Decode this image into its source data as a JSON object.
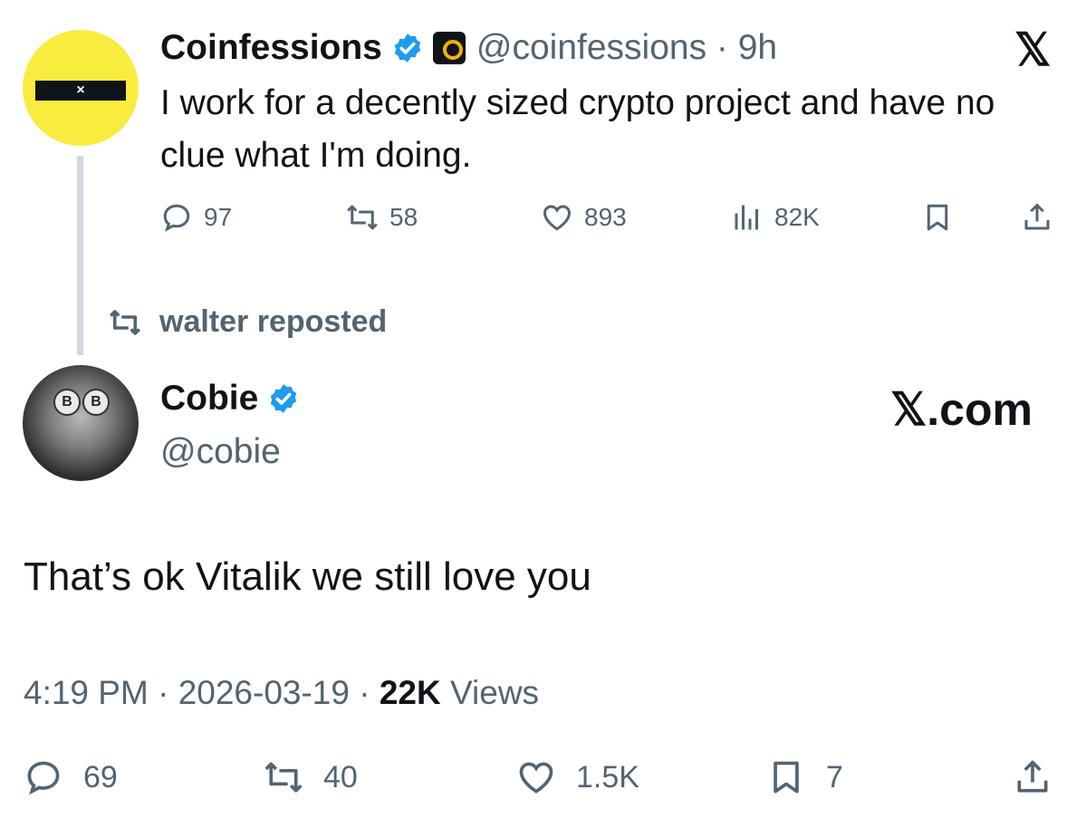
{
  "quoted_tweet": {
    "author_name": "Coinfessions",
    "handle_time": "@coinfessions · 9h",
    "avatar_text": "×",
    "text": "I work for a decently sized crypto project and have no clue what I'm doing.",
    "replies": "97",
    "reposts": "58",
    "likes": "893",
    "views": "82K"
  },
  "repost_banner": "walter reposted",
  "main_tweet": {
    "author_name": "Cobie",
    "handle": "@cobie",
    "text": "That’s ok Vitalik we still love you",
    "time": "4:19 PM",
    "date": "2026-03-19",
    "views_count": "22K",
    "views_label": "Views",
    "replies": "69",
    "reposts": "40",
    "likes": "1.5K",
    "bookmarks": "7",
    "avatar_glass_text": "B"
  },
  "branding": {
    "x_logo": "𝕏",
    "x_com": "𝕏.com"
  },
  "colors": {
    "verified": "#1d9bf0",
    "muted": "#536471",
    "avatar_yellow": "#faec3f"
  }
}
